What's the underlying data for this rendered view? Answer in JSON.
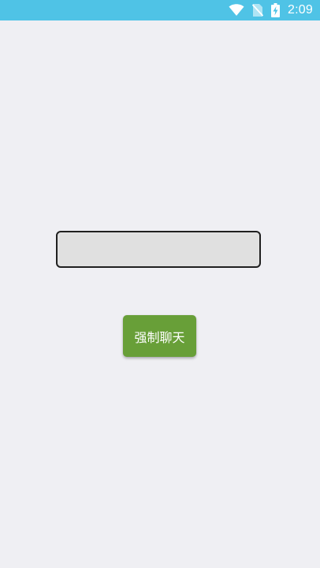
{
  "status_bar": {
    "time": "2:09",
    "background_color": "#4fc3e6",
    "icons": [
      "wifi-icon",
      "no-sim-icon",
      "battery-charging-icon"
    ]
  },
  "form": {
    "input_value": "",
    "input_placeholder": "",
    "button_label": "强制聊天",
    "button_color": "#689f38"
  }
}
